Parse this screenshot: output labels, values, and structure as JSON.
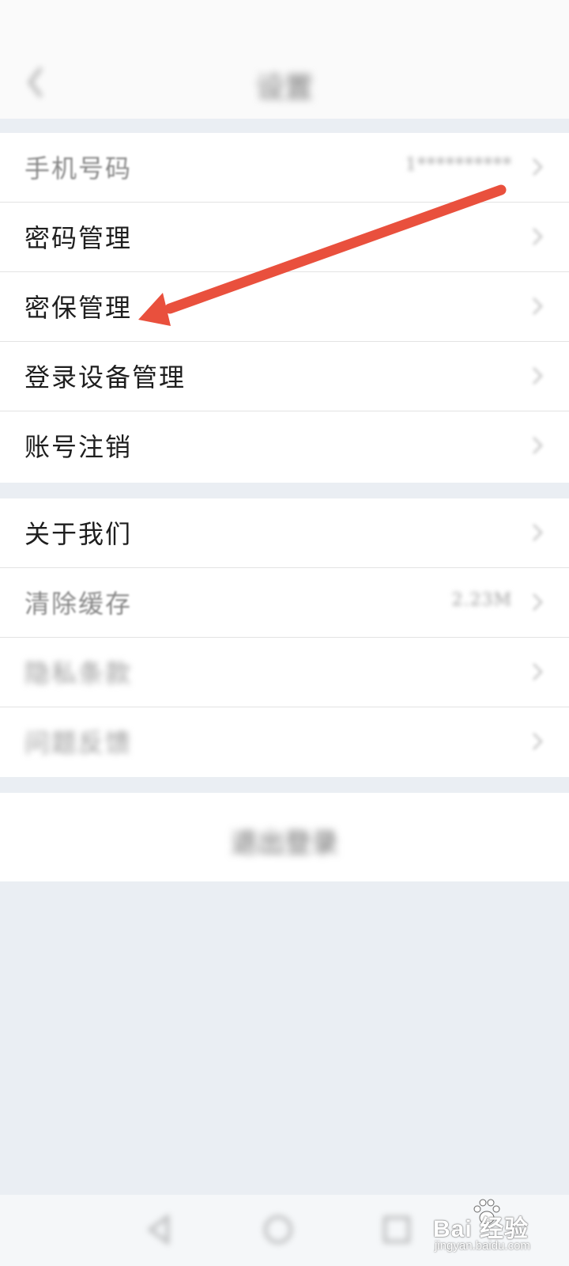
{
  "nav": {
    "title": "设置"
  },
  "group1": [
    {
      "label": "手机号码",
      "value": "1**********"
    },
    {
      "label": "密码管理"
    },
    {
      "label": "密保管理"
    },
    {
      "label": "登录设备管理"
    },
    {
      "label": "账号注销"
    }
  ],
  "group2": [
    {
      "label": "关于我们"
    },
    {
      "label": "清除缓存",
      "value": "2.23M"
    },
    {
      "label": "隐私条款"
    },
    {
      "label": "问题反馈"
    }
  ],
  "logout_label": "退出登录",
  "annotation": {
    "color": "#e9503d",
    "points_to": "密保管理"
  },
  "watermark": {
    "brand": "Bai 经验",
    "url": "jingyan.baidu.com"
  },
  "icons": [
    "back-icon",
    "chevron-right-icon",
    "back-triangle-icon",
    "home-circle-icon",
    "recent-square-icon",
    "paw-logo-icon"
  ]
}
